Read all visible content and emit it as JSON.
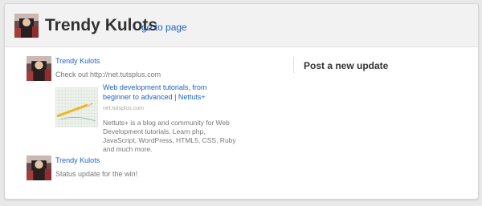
{
  "header": {
    "title": "Trendy Kulots",
    "goto_label": "go to page"
  },
  "post_panel": {
    "title": "Post a new update"
  },
  "feed": [
    {
      "author": "Trendy Kulots",
      "message": "Check out http://net.tutsplus.com",
      "link": {
        "title": "Web development tutorials, from beginner to advanced | Nettuts+",
        "domain": "net.tutsplus.com",
        "description": "Nettuts+ is a blog and community for Web Development tutorials. Learn php, JavaScript, WordPress, HTML5, CSS, Ruby and much more."
      }
    },
    {
      "author": "Trendy Kulots",
      "message": "Status update for the win!"
    }
  ],
  "colors": {
    "link": "#1f63c2",
    "header_bg": "#f2f2f2",
    "page_bg": "#e9e9e9"
  },
  "icons": {
    "avatar": "profile-photo",
    "link_thumbnail": "pencil-on-grid-paper"
  }
}
